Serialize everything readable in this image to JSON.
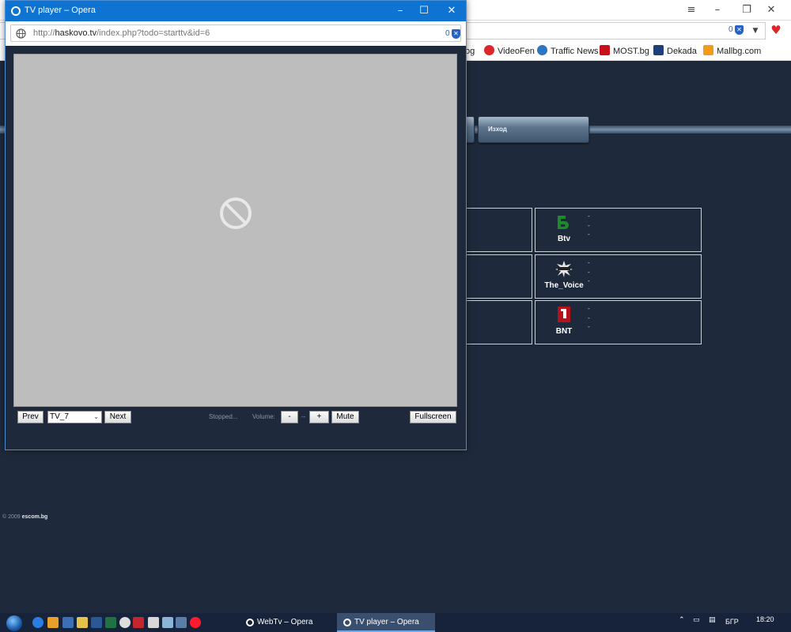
{
  "background_window": {
    "bookmarks": [
      {
        "label": "og",
        "color": "#ffffff"
      },
      {
        "label": "VideoFen",
        "color": "#e0252a"
      },
      {
        "label": "Traffic News",
        "color": "#2e76c2"
      },
      {
        "label": "MOST.bg",
        "color": "#c8101c"
      },
      {
        "label": "Dekada",
        "color": "#1d3f7a"
      },
      {
        "label": "Mallbg.com",
        "color": "#f29a1b"
      }
    ],
    "badge_count": "0",
    "page": {
      "nav_exit": "Изход",
      "channels": [
        {
          "name": "Btv",
          "lines": [
            "-",
            "-",
            "-"
          ],
          "logo": "btv-logo",
          "color": "#1f8a2b"
        },
        {
          "name": "The_Voice",
          "lines": [
            "-",
            "-",
            "-"
          ],
          "logo": "the-voice-logo",
          "color": "#ffffff"
        },
        {
          "name": "BNT",
          "lines": [
            "-",
            "-",
            "-"
          ],
          "logo": "bnt-logo",
          "color": "#b3141b"
        }
      ],
      "footer_copyright": "© 2009",
      "footer_brand": "escom.bg"
    }
  },
  "popup": {
    "title": "TV player – Opera",
    "url_prefix": "http://",
    "url_host": "haskovo.tv",
    "url_path": "/index.php?todo=starttv&id=6",
    "badge_count": "0",
    "player": {
      "state_icon": "blocked-plugin-icon",
      "prev_label": "Prev",
      "channel_selected": "TV_7",
      "next_label": "Next",
      "status": "Stopped...",
      "volume_label": "Volume:",
      "vol_down": "-",
      "vol_level": "--",
      "vol_up": "+",
      "mute_label": "Mute",
      "fullscreen_label": "Fullscreen"
    }
  },
  "taskbar": {
    "tasks": [
      {
        "label": "WebTv – Opera",
        "active": false
      },
      {
        "label": "TV player – Opera",
        "active": true
      }
    ],
    "language": "БГР",
    "time": "18:20"
  }
}
